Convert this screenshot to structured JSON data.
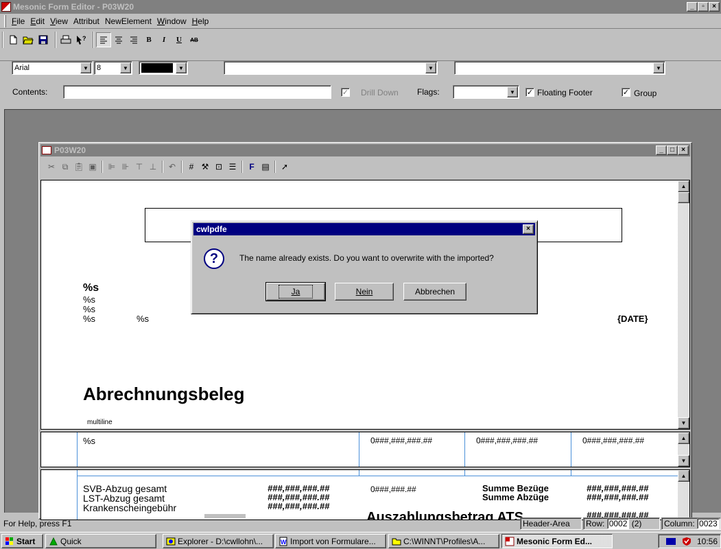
{
  "app": {
    "title": "Mesonic Form Editor - P03W20",
    "minimize": "_",
    "restore": "▫",
    "close": "×"
  },
  "menu": [
    {
      "label": "File",
      "key": "F"
    },
    {
      "label": "Edit",
      "key": "E"
    },
    {
      "label": "View",
      "key": "V"
    },
    {
      "label": "Attribut",
      "key": ""
    },
    {
      "label": "NewElement",
      "key": ""
    },
    {
      "label": "Window",
      "key": "W"
    },
    {
      "label": "Help",
      "key": "H"
    }
  ],
  "format": {
    "font": "Arial",
    "size": "8",
    "color": "#000000",
    "bold": "B",
    "italic": "I",
    "underline": "U",
    "strike": "AB"
  },
  "props": {
    "contents_label": "Contents:",
    "contents_value": "",
    "drilldown_label": "Drill Down",
    "flags_label": "Flags:",
    "floating_footer_label": "Floating Footer",
    "group_label": "Group",
    "check": "✓"
  },
  "child": {
    "title": "P03W20"
  },
  "report": {
    "pane1": {
      "s_bold": "%s",
      "s1": "%s",
      "s2": "%s",
      "s3": "%s",
      "s4": "%s",
      "date": "{DATE}",
      "heading": "Abrechnungsbeleg",
      "multiline": "multiline"
    },
    "pane2": {
      "s": "%s",
      "c1": "0###,###,###.##",
      "c2": "0###,###,###.##",
      "c3": "0###,###,###.##"
    },
    "pane3": {
      "lines": [
        "SVB-Abzug gesamt",
        "LST-Abzug gesamt",
        "Krankenscheingebühr"
      ],
      "amounts": [
        "###,###,###.##",
        "###,###,###.##",
        "###,###,###.##"
      ],
      "mid": "0###,###.##",
      "sum_labels": [
        "Summe Bezüge",
        "Summe Abzüge"
      ],
      "sum_values": [
        "###,###,###.##",
        "###,###,###.##"
      ],
      "cut_text": "Auszahlungsbetrag ATS",
      "cut_value": "###,###,###.##"
    }
  },
  "dialog": {
    "title": "cwlpdfe",
    "message": "The name already exists. Do you want to overwrite with the imported?",
    "yes": "Ja",
    "no": "Nein",
    "cancel": "Abbrechen",
    "close": "×",
    "icon": "?"
  },
  "status": {
    "help": "For Help, press F1",
    "area": "Header-Area",
    "row_label": "Row:",
    "row_value": "0002",
    "row_extra": "(2)",
    "col_label": "Column:",
    "col_value": "0023"
  },
  "taskbar": {
    "start": "Start",
    "quick": "Quick",
    "items": [
      "Explorer - D:\\cwllohn\\...",
      "Import von Formulare...",
      "C:\\WINNT\\Profiles\\A...",
      "Mesonic Form Ed..."
    ],
    "clock": "10:56"
  }
}
